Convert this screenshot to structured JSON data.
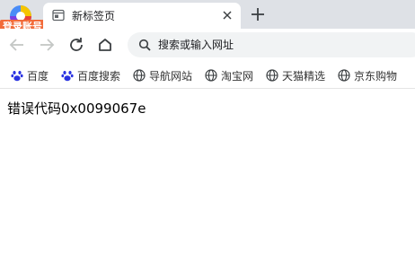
{
  "browser": {
    "login_badge": "登录账号",
    "tab": {
      "title": "新标签页"
    },
    "omnibox": {
      "placeholder": "搜索或输入网址"
    }
  },
  "bookmarks": [
    {
      "label": "百度",
      "icon": "baidu-paw-icon"
    },
    {
      "label": "百度搜索",
      "icon": "baidu-paw-icon"
    },
    {
      "label": "导航网站",
      "icon": "globe-icon"
    },
    {
      "label": "淘宝网",
      "icon": "globe-icon"
    },
    {
      "label": "天猫精选",
      "icon": "globe-icon"
    },
    {
      "label": "京东购物",
      "icon": "globe-icon"
    }
  ],
  "page": {
    "error_text": "错误代码0x0099067e"
  },
  "colors": {
    "tabstrip": "#dee1e6",
    "badge": "#f26b3a",
    "baidu_blue": "#2932e1",
    "icon_gray": "#5f6368"
  }
}
